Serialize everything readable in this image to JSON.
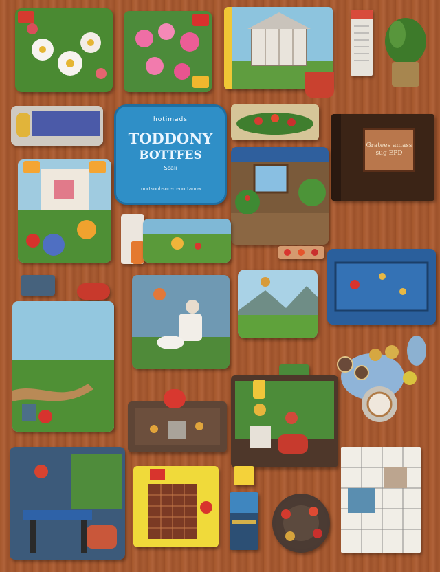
{
  "sign": {
    "small_text": "hotimads",
    "title_line1": "TODDONY",
    "title_line2": "BOTTFES",
    "subtitle": "Scali",
    "footer": "toortsoohsoo-rn-nottanow"
  },
  "book": {
    "label": "Gratees amass sug EPD"
  },
  "colors": {
    "wood": "#a5582d",
    "sign_blue": "#2f8fc7",
    "board_blue": "#2a5f9c",
    "panel_yellow": "#f1dc3b"
  }
}
